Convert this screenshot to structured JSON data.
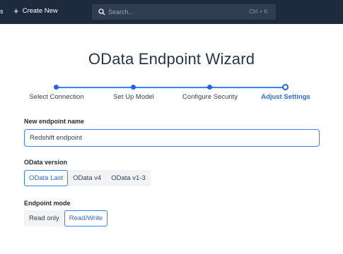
{
  "topbar": {
    "nav_fragment": "s",
    "create_new_label": "Create New",
    "search_placeholder": "Search...",
    "search_shortcut": "Ctrl + K"
  },
  "wizard": {
    "title": "OData Endpoint Wizard",
    "steps": [
      {
        "label": "Select Connection",
        "state": "done"
      },
      {
        "label": "Set Up Model",
        "state": "done"
      },
      {
        "label": "Configure Security",
        "state": "done"
      },
      {
        "label": "Adjust Settings",
        "state": "current"
      }
    ]
  },
  "form": {
    "endpoint_name": {
      "label": "New endpoint name",
      "value": "Redshift endpoint"
    },
    "odata_version": {
      "label": "OData version",
      "options": [
        "OData Last",
        "OData v4",
        "OData v1-3"
      ],
      "selected": "OData Last"
    },
    "endpoint_mode": {
      "label": "Endpoint mode",
      "options": [
        "Read only",
        "Read/Write"
      ],
      "selected": "Read/Write"
    }
  },
  "colors": {
    "topbar": "#1e2b3f",
    "accent": "#2563eb",
    "active_text": "#2f6cdd"
  }
}
